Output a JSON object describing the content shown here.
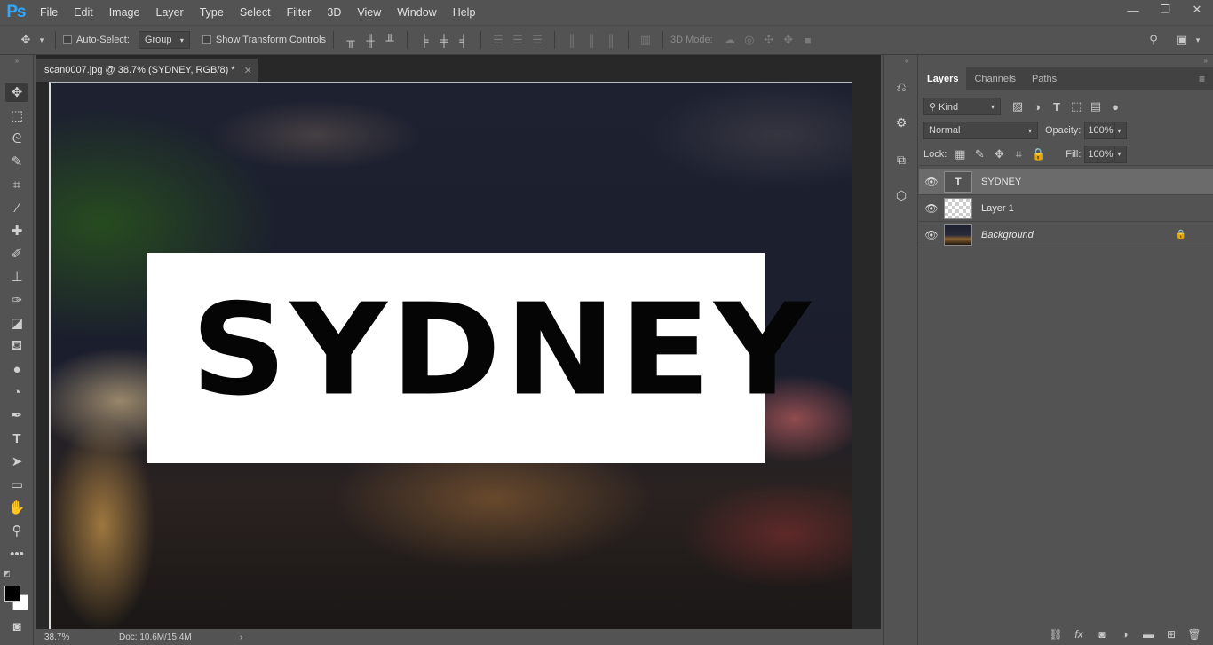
{
  "app": {
    "logo": "Ps"
  },
  "menu": [
    "File",
    "Edit",
    "Image",
    "Layer",
    "Type",
    "Select",
    "Filter",
    "3D",
    "View",
    "Window",
    "Help"
  ],
  "window_controls": {
    "minimize": "—",
    "restore": "❐",
    "close": "✕"
  },
  "options": {
    "auto_select_label": "Auto-Select:",
    "auto_select_checked": false,
    "auto_select_value": "Group",
    "show_transform_label": "Show Transform Controls",
    "show_transform_checked": false,
    "mode_3d_label": "3D Mode:"
  },
  "document": {
    "tab_title": "scan0007.jpg @ 38.7% (SYDNEY, RGB/8) *",
    "canvas_text": "SYDNEY",
    "zoom": "38.7%",
    "doc_size": "Doc: 10.6M/15.4M"
  },
  "panel": {
    "tabs": [
      "Layers",
      "Channels",
      "Paths"
    ],
    "active_tab": "Layers",
    "filter_kind": "Kind",
    "blend_mode": "Normal",
    "opacity_label": "Opacity:",
    "opacity_value": "100%",
    "lock_label": "Lock:",
    "fill_label": "Fill:",
    "fill_value": "100%",
    "layers": [
      {
        "name": "SYDNEY",
        "type": "text",
        "visible": true,
        "selected": true
      },
      {
        "name": "Layer 1",
        "type": "pixel",
        "visible": true,
        "selected": false
      },
      {
        "name": "Background",
        "type": "background",
        "visible": true,
        "selected": false,
        "locked": true
      }
    ]
  },
  "colors": {
    "ui_bg": "#535353",
    "ui_dark": "#424242",
    "canvas_bg": "#282828",
    "selected_layer": "#6b6b6b",
    "ps_blue": "#31a8ff",
    "foreground_swatch": "#000000",
    "background_swatch": "#ffffff"
  }
}
